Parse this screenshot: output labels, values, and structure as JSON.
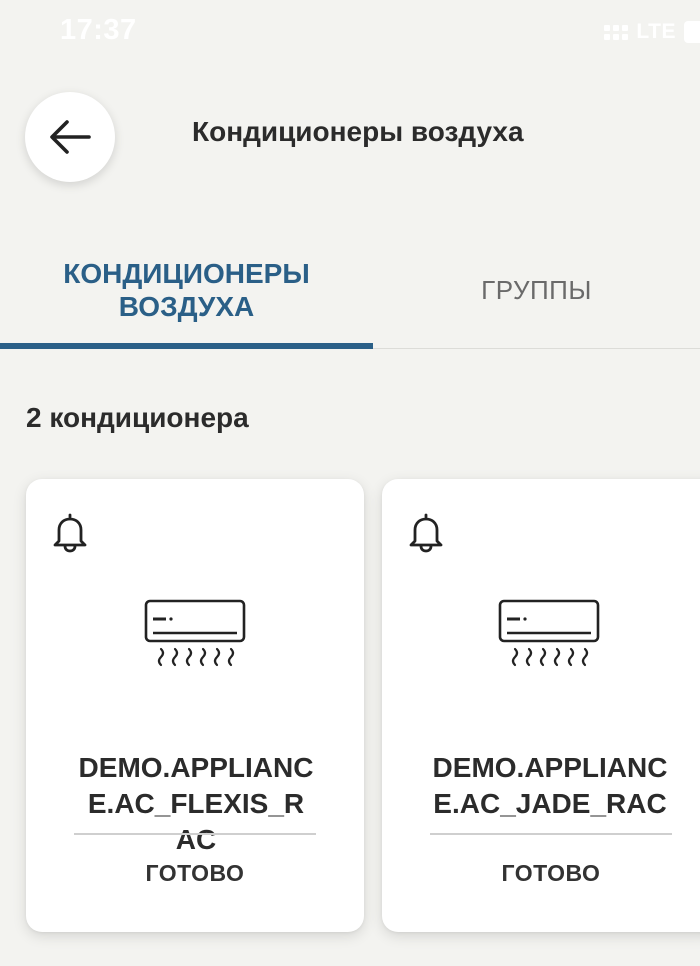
{
  "status_bar": {
    "time": "17:37",
    "network": "LTE"
  },
  "header": {
    "back_icon": "arrow-left-icon",
    "title": "Кондиционеры воздуха"
  },
  "tabs": [
    {
      "label_line1": "КОНДИЦИОНЕРЫ",
      "label_line2": "ВОЗДУХА",
      "active": true
    },
    {
      "label": "ГРУППЫ",
      "active": false
    }
  ],
  "summary": {
    "count_label": "2 кондиционера"
  },
  "devices": [
    {
      "name": "DEMO.APPLIANCE.AC_FLEXIS_RAC",
      "status": "ГОТОВО",
      "notification_icon": "bell-icon",
      "device_icon": "air-conditioner-icon"
    },
    {
      "name": "DEMO.APPLIANCE.AC_JADE_RAC",
      "status": "ГОТОВО",
      "notification_icon": "bell-icon",
      "device_icon": "air-conditioner-icon"
    }
  ],
  "colors": {
    "accent": "#2a5f87",
    "background": "#f3f3f0",
    "card": "#ffffff"
  }
}
